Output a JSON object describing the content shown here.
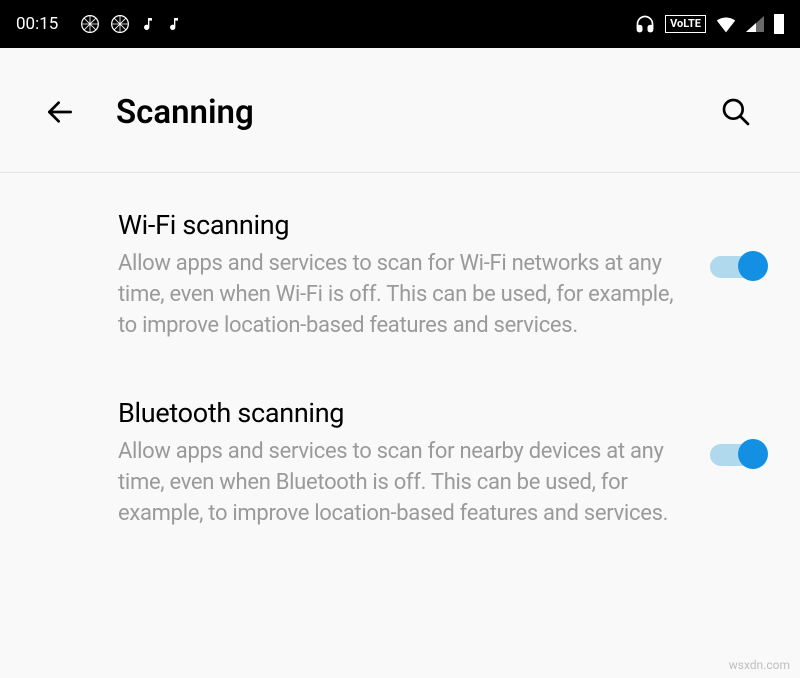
{
  "status_bar": {
    "time": "00:15",
    "volte": "VoLTE"
  },
  "header": {
    "title": "Scanning"
  },
  "settings": [
    {
      "title": "Wi-Fi scanning",
      "description": "Allow apps and services to scan for Wi-Fi networks at any time, even when Wi-Fi is off. This can be used, for example, to improve location-based features and services.",
      "enabled": true
    },
    {
      "title": "Bluetooth scanning",
      "description": "Allow apps and services to scan for nearby devices at any time, even when Bluetooth is off. This can be used, for example, to improve location-based features and services.",
      "enabled": true
    }
  ],
  "watermark": "wsxdn.com"
}
